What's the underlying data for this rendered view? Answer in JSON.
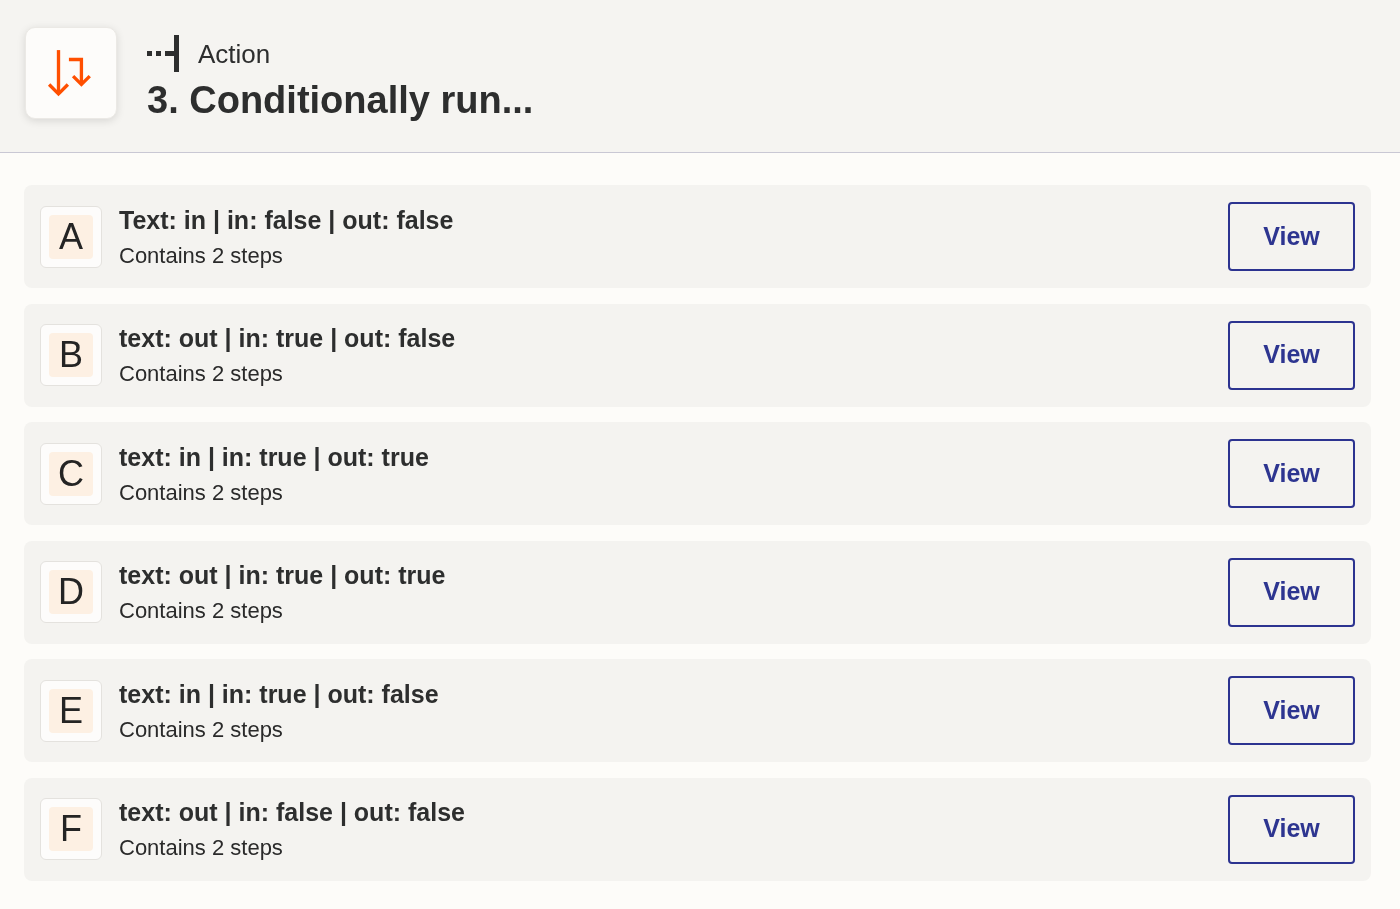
{
  "header": {
    "label": "Action",
    "title": "3. Conditionally run..."
  },
  "paths": [
    {
      "letter": "A",
      "title": "Text: in | in: false | out: false",
      "subtitle": "Contains 2 steps",
      "button": "View"
    },
    {
      "letter": "B",
      "title": "text: out | in: true | out: false",
      "subtitle": "Contains 2 steps",
      "button": "View"
    },
    {
      "letter": "C",
      "title": "text: in | in: true | out: true",
      "subtitle": "Contains 2 steps",
      "button": "View"
    },
    {
      "letter": "D",
      "title": "text: out | in: true | out: true",
      "subtitle": "Contains 2 steps",
      "button": "View"
    },
    {
      "letter": "E",
      "title": "text: in | in: true | out: false",
      "subtitle": "Contains 2 steps",
      "button": "View"
    },
    {
      "letter": "F",
      "title": "text: out | in: false | out: false",
      "subtitle": "Contains 2 steps",
      "button": "View"
    }
  ]
}
